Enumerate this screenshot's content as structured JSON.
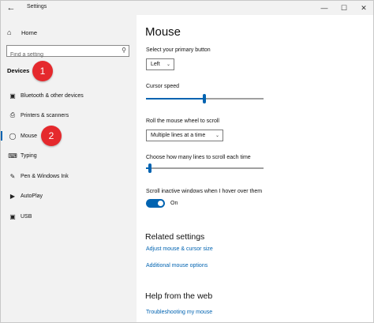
{
  "window": {
    "title": "Settings",
    "back_icon": "back-arrow-icon",
    "controls": {
      "minimize": "—",
      "maximize": "☐",
      "close": "✕"
    }
  },
  "sidebar": {
    "home": {
      "label": "Home",
      "icon": "home-icon"
    },
    "search": {
      "placeholder": "Find a setting",
      "icon": "search-icon"
    },
    "section_title": "Devices",
    "items": [
      {
        "label": "Bluetooth & other devices",
        "icon": "bluetooth-devices-icon",
        "selected": false
      },
      {
        "label": "Printers & scanners",
        "icon": "printer-icon",
        "selected": false
      },
      {
        "label": "Mouse",
        "icon": "mouse-icon",
        "selected": true
      },
      {
        "label": "Typing",
        "icon": "keyboard-icon",
        "selected": false
      },
      {
        "label": "Pen & Windows Ink",
        "icon": "pen-icon",
        "selected": false
      },
      {
        "label": "AutoPlay",
        "icon": "autoplay-icon",
        "selected": false
      },
      {
        "label": "USB",
        "icon": "usb-icon",
        "selected": false
      }
    ]
  },
  "annotations": {
    "badge_1": "1",
    "badge_2": "2",
    "badge_color": "#e5292d"
  },
  "main": {
    "title": "Mouse",
    "primary_button": {
      "label": "Select your primary button",
      "value": "Left"
    },
    "cursor_speed": {
      "label": "Cursor speed",
      "level": 0.48
    },
    "scroll_wheel": {
      "label": "Roll the mouse wheel to scroll",
      "value": "Multiple lines at a time"
    },
    "lines_to_scroll": {
      "label": "Choose how many lines to scroll each time",
      "level": 0.02
    },
    "scroll_inactive": {
      "label": "Scroll inactive windows when I hover over them",
      "state": "On"
    },
    "related": {
      "heading": "Related settings",
      "links": [
        "Adjust mouse & cursor size",
        "Additional mouse options"
      ]
    },
    "help": {
      "heading": "Help from the web",
      "links": [
        "Troubleshooting my mouse"
      ]
    }
  },
  "colors": {
    "accent": "#0063b1",
    "sidebar_bg": "#f2f2f2",
    "badge": "#e5292d"
  }
}
